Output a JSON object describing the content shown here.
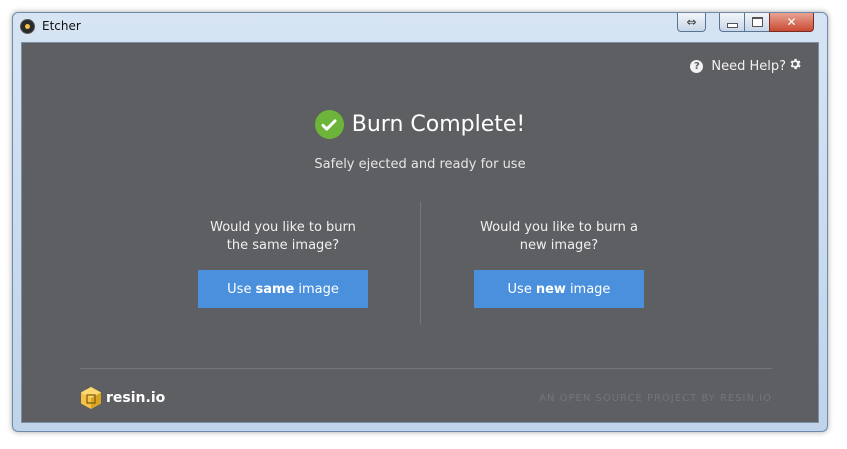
{
  "window": {
    "title": "Etcher",
    "controls": {
      "resize_glyph": "⇔",
      "close_glyph": "✕"
    }
  },
  "header": {
    "help_label": "Need Help?",
    "help_icon_glyph": "?",
    "settings_icon": "gear-icon"
  },
  "status": {
    "title": "Burn Complete!",
    "subtitle": "Safely ejected and ready for use",
    "icon": "check-circle-icon",
    "icon_color": "#6cb53a"
  },
  "options": {
    "same": {
      "question": "Would you like to burn\nthe same image?",
      "button_prefix": "Use",
      "button_bold": "same",
      "button_suffix": "image"
    },
    "new": {
      "question": "Would you like to burn a\nnew image?",
      "button_prefix": "Use",
      "button_bold": "new",
      "button_suffix": "image"
    }
  },
  "footer": {
    "logo_text": "resin.io",
    "logo_icon": "resin-cube-icon",
    "tagline": "AN OPEN SOURCE PROJECT BY RESIN.IO"
  },
  "colors": {
    "background": "#5e5f63",
    "button": "#4a90dc",
    "logo_yellow": "#f6c245"
  }
}
